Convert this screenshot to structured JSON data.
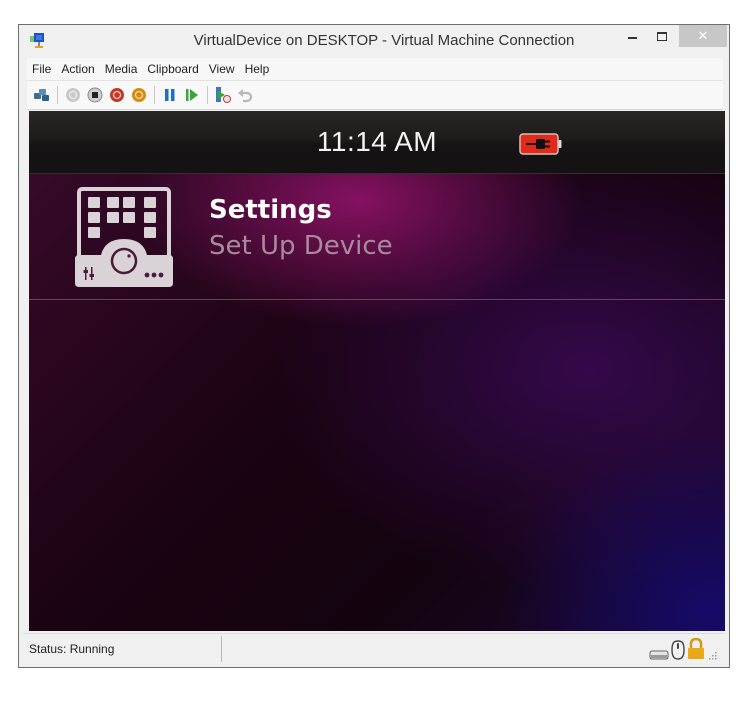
{
  "window": {
    "title": "VirtualDevice on DESKTOP - Virtual Machine Connection",
    "controls": {
      "minimize": "‒",
      "maximize": "☐",
      "close": "✕"
    }
  },
  "menu": [
    "File",
    "Action",
    "Media",
    "Clipboard",
    "View",
    "Help"
  ],
  "toolbar": {
    "buttons": [
      {
        "name": "ctrl-alt-del",
        "icon": "keyboard-keys-icon"
      },
      {
        "name": "start",
        "icon": "start-icon",
        "state": "disabled"
      },
      {
        "name": "turn-off",
        "icon": "turn-off-icon"
      },
      {
        "name": "shut-down",
        "icon": "shut-down-icon",
        "color": "#c0392b"
      },
      {
        "name": "save",
        "icon": "save-state-icon",
        "color": "#d68a10"
      },
      {
        "name": "pause",
        "icon": "pause-icon",
        "color": "#1e6fc0"
      },
      {
        "name": "resume",
        "icon": "resume-icon",
        "color": "#3aa63a"
      },
      {
        "name": "checkpoint",
        "icon": "checkpoint-icon"
      },
      {
        "name": "revert",
        "icon": "revert-icon",
        "state": "disabled"
      }
    ]
  },
  "device": {
    "clock": "11:14 AM",
    "battery": {
      "state": "charging",
      "color": "#e02a1a"
    },
    "app": {
      "title": "Settings",
      "subtitle": "Set Up Device"
    }
  },
  "statusbar": {
    "status": "Status: Running",
    "tray": [
      "keyboard-icon",
      "mouse-icon",
      "lock-icon"
    ]
  }
}
